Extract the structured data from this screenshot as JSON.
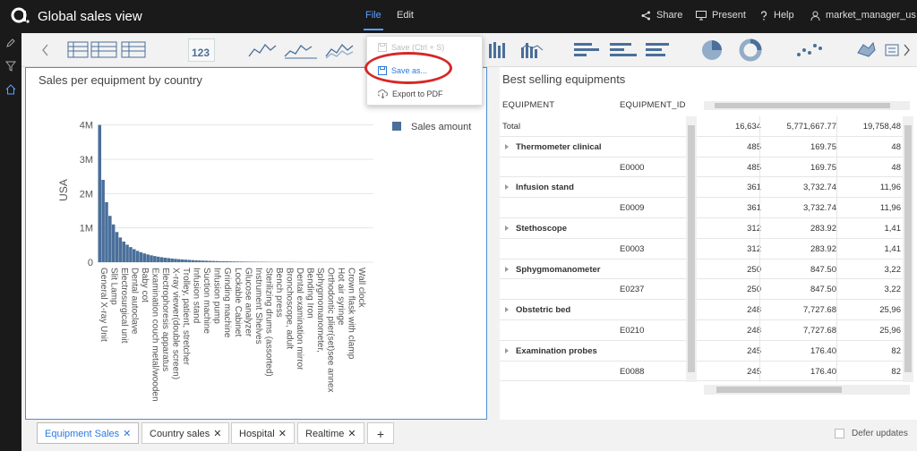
{
  "app": {
    "title": "Global sales view",
    "menu_file": "File",
    "menu_edit": "Edit",
    "share": "Share",
    "present": "Present",
    "help": "Help",
    "user": "market_manager_us"
  },
  "toolbar": {
    "kpi_label": "123"
  },
  "file_menu": {
    "save": "Save (Ctrl + S)",
    "save_as": "Save as...",
    "export_pdf": "Export to PDF"
  },
  "chart_panel": {
    "title": "Sales per equipment by country"
  },
  "chart_data": {
    "type": "bar",
    "ylabel": "USA",
    "ylim": [
      0,
      4200000
    ],
    "y_ticks": [
      0,
      1000000,
      2000000,
      3000000,
      4000000
    ],
    "y_tick_labels": [
      "0",
      "1M",
      "2M",
      "3M",
      "4M"
    ],
    "series": [
      {
        "name": "Sales amount",
        "color": "#4a6f9a",
        "values": [
          4000000,
          2400000,
          1750000,
          1350000,
          1100000,
          880000,
          720000,
          600000,
          510000,
          440000,
          380000,
          330000,
          290000,
          255000,
          225000,
          200000,
          180000,
          160000,
          145000,
          130000,
          118000,
          107000,
          97000,
          88000,
          80000,
          73000,
          66000,
          60000,
          55000,
          50000,
          46000,
          42000,
          38000,
          35000,
          32000,
          29000,
          27000,
          25000,
          23000,
          21000,
          19000,
          17500,
          16000,
          14500,
          13000,
          12000,
          11000,
          10000,
          9000,
          8200,
          7500,
          6800,
          6200,
          5600,
          5100,
          4600,
          4200,
          3800,
          3400,
          3000,
          2700,
          2400,
          2100,
          1900,
          1700,
          1500,
          1300,
          1100,
          950,
          800,
          700,
          600,
          500,
          420,
          350,
          280,
          220,
          170,
          120,
          80
        ]
      }
    ],
    "x_tick_labels": [
      "General X-ray Unit",
      "Slit Lamp",
      "Electrosurgical unit",
      "Dental autoclave",
      "Baby cot",
      "Examination couch metal/wooden",
      "Electrophoresis apparatus",
      "X-ray viewer(double screen)",
      "Trolley, patient, stretcher",
      "Infusion stand",
      "Suction machine",
      "Infusion pump",
      "Grinding machine",
      "Lockable Cabinet",
      "Glucose analyzer",
      "Instrument Shelves",
      "Sterilizing drums (assorted)",
      "Bench press",
      "Bronchoscope, adult",
      "Dental examination mirror",
      "Bending Iron",
      "Sphygmomanometer,",
      "Orthodontic plier(set)see annex",
      "Hot air syringe",
      "Crown flask with clamp",
      "Wall clock"
    ]
  },
  "table_panel": {
    "title": "Best selling equipments",
    "headers": [
      "EQUIPMENT",
      "EQUIPMENT_ID"
    ],
    "total_label": "Total",
    "total_values": [
      "16,634",
      "5,771,667.77",
      "19,758,48"
    ],
    "rows": [
      {
        "name": "Thermometer clinical",
        "id": "E0000",
        "v1": "485",
        "v2": "169.75",
        "v3": "48"
      },
      {
        "name": "Infusion stand",
        "id": "E0009",
        "v1": "361",
        "v2": "3,732.74",
        "v3": "11,96"
      },
      {
        "name": "Stethoscope",
        "id": "E0003",
        "v1": "312",
        "v2": "283.92",
        "v3": "1,41"
      },
      {
        "name": "Sphygmomanometer",
        "id": "E0237",
        "v1": "250",
        "v2": "847.50",
        "v3": "3,22"
      },
      {
        "name": "Obstetric bed",
        "id": "E0210",
        "v1": "248",
        "v2": "7,727.68",
        "v3": "25,96"
      },
      {
        "name": "Examination probes",
        "id": "E0088",
        "v1": "245",
        "v2": "176.40",
        "v3": "82"
      }
    ]
  },
  "bottom": {
    "tabs": [
      "Equipment Sales",
      "Country sales",
      "Hospital",
      "Realtime"
    ],
    "add": "+",
    "defer_updates": "Defer updates"
  },
  "colors": {
    "accent": "#2a7ae2",
    "bar": "#4a6f9a",
    "topbar": "#1a1a1a",
    "highlight": "#d62728"
  }
}
